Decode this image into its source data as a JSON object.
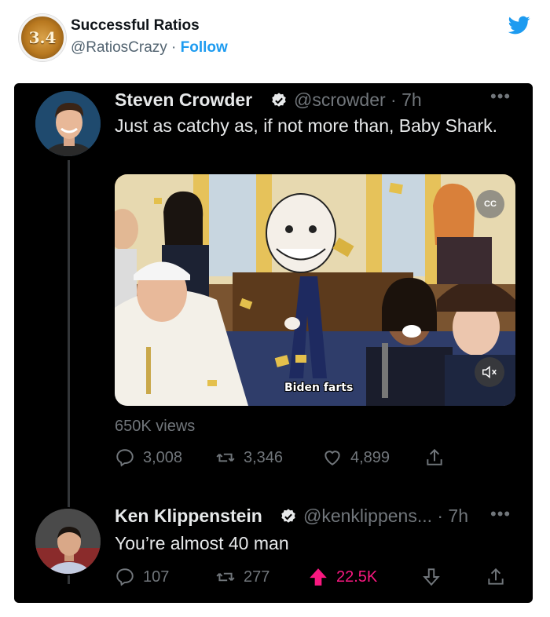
{
  "embed": {
    "account_name": "Successful Ratios",
    "account_handle": "@RatiosCrazy",
    "separator": "·",
    "follow_label": "Follow",
    "avatar_text": "3.4",
    "avatar_icon": "coin-logo-icon",
    "brand_icon": "twitter-bird-icon",
    "brand_color": "#1d9bf0"
  },
  "tweet": {
    "author_name": "Steven Crowder",
    "author_handle": "@scrowder · 7h",
    "text": "Just as catchy as, if not more than, Baby Shark.",
    "media": {
      "caption": "Biden farts",
      "cc_label": "CC"
    },
    "views": "650K views",
    "actions": {
      "replies": "3,008",
      "retweets": "3,346",
      "likes": "4,899"
    }
  },
  "reply": {
    "author_name": "Ken Klippenstein",
    "author_handle": "@kenklippens... · 7h",
    "text": "You’re almost 40 man",
    "actions": {
      "replies": "107",
      "retweets": "277",
      "upvotes": "22.5K"
    }
  },
  "colors": {
    "background_dark": "#000000",
    "text_light": "#e7e9ea",
    "muted": "#71767b",
    "verified": "#e7e9ea",
    "upvote": "#f91880"
  }
}
